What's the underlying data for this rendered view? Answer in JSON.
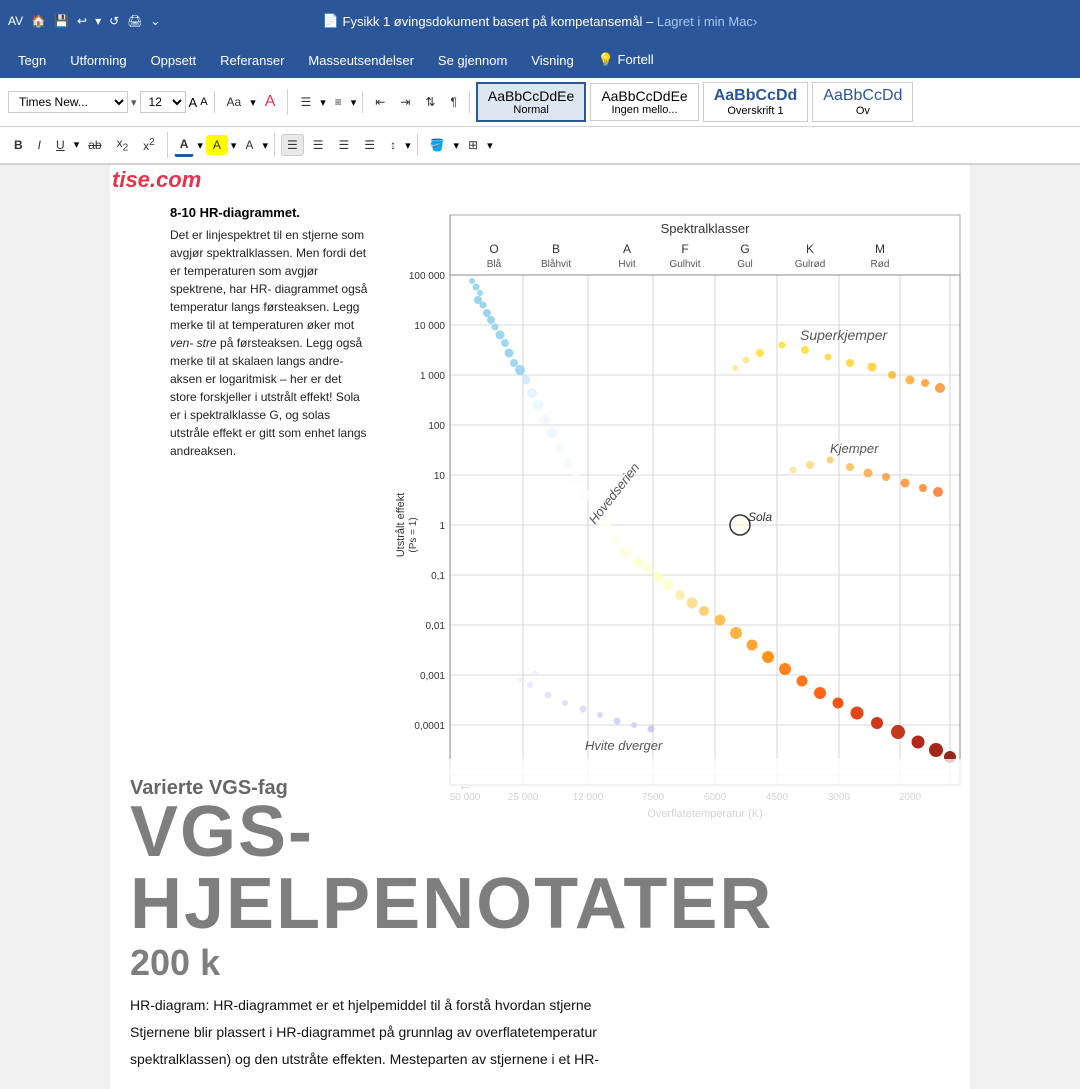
{
  "titleBar": {
    "docName": "Fysikk 1 øvingsdokument basert på kompetansemål",
    "savedStatus": "Lagret i min Mac",
    "savedStatusSuffix": " ›",
    "docIcon": "📄"
  },
  "menuBar": {
    "items": [
      "Tegn",
      "Utforming",
      "Oppsett",
      "Referanser",
      "Masseutsendelser",
      "Se gjennom",
      "Visning",
      "💡 Fortell"
    ]
  },
  "toolbar1": {
    "font": "Times New...",
    "fontSize": "12",
    "stylePresets": [
      {
        "id": "normal",
        "label": "Normal",
        "sample": "AaBbCcDdEe",
        "active": true
      },
      {
        "id": "ingen",
        "label": "Ingen mello...",
        "sample": "AaBbCcDdEe",
        "active": false
      },
      {
        "id": "overskrift1",
        "label": "Overskrift 1",
        "sample": "AaBbCcDd",
        "active": false
      },
      {
        "id": "overskrift2",
        "label": "Ov",
        "sample": "AaBbCcDd",
        "active": false
      }
    ]
  },
  "toolbar2": {
    "buttons": [
      "B",
      "I",
      "U",
      "ab",
      "x₂",
      "x²",
      "A",
      "A",
      "A"
    ]
  },
  "tise": {
    "logo": "tise",
    "domain": ".com"
  },
  "document": {
    "section": "8-10 HR-diagrammet.",
    "body": "Det er linjespektret til en stjerne som avgjør spektralklassen. Men fordi det er temperaturen som avgjør spektrene, har HR-diagrammet også temperatur langs førsteaksen. Legg merke til at temperaturen øker mot ven-stre på førsteaksen. Legg også merke til at skalaen langs andreaksen er logaritmisk – her er det store forskjeller i utstrålt effekt! Sola er i spektralklasse G, og solas utstråle effekt er gitt som enhet langs andreaksen."
  },
  "hrDiagram": {
    "title": "Spektralklasser",
    "xAxisLabel": "Overflatetemperatur (K)",
    "yAxisLabel": "Utstrålt effekt (Ps = 1)",
    "spectralClasses": [
      "O",
      "B",
      "A",
      "F",
      "G",
      "K",
      "M"
    ],
    "spectralColors": [
      "Blå",
      "Blåhvit",
      "Hvit",
      "Gulhvit",
      "Gul",
      "Gulrød",
      "Rød"
    ],
    "xValues": [
      "50 000",
      "25 000",
      "12 000",
      "7500",
      "6000",
      "4500",
      "3000",
      "2000"
    ],
    "yValues": [
      "100 000",
      "10 000",
      "1 000",
      "100",
      "10",
      "1",
      "0,1",
      "0,01",
      "0,001",
      "0,0001"
    ],
    "labels": [
      "Superkjemper",
      "Kjemper",
      "Sola",
      "Hovedserien",
      "Hvite dverger"
    ],
    "solaMarker": {
      "x": "G class",
      "y": "1"
    }
  },
  "vgsOverlay": {
    "subtitle": "Varierte VGS-fag",
    "title": "VGS-HJELPENOTATER",
    "count": "200 k",
    "bodyText1": "HR-diagram: HR-diagrammet er et hjelpemiddel til å forstå hvordan stjerne",
    "bodyText2": "Stjernene blir plassert i HR-diagrammet på grunnlag av overflatetemperatur",
    "bodyText3": "spektralklassen) og den utstråte effekten. Mesteparten av stjernene i et HR-"
  }
}
